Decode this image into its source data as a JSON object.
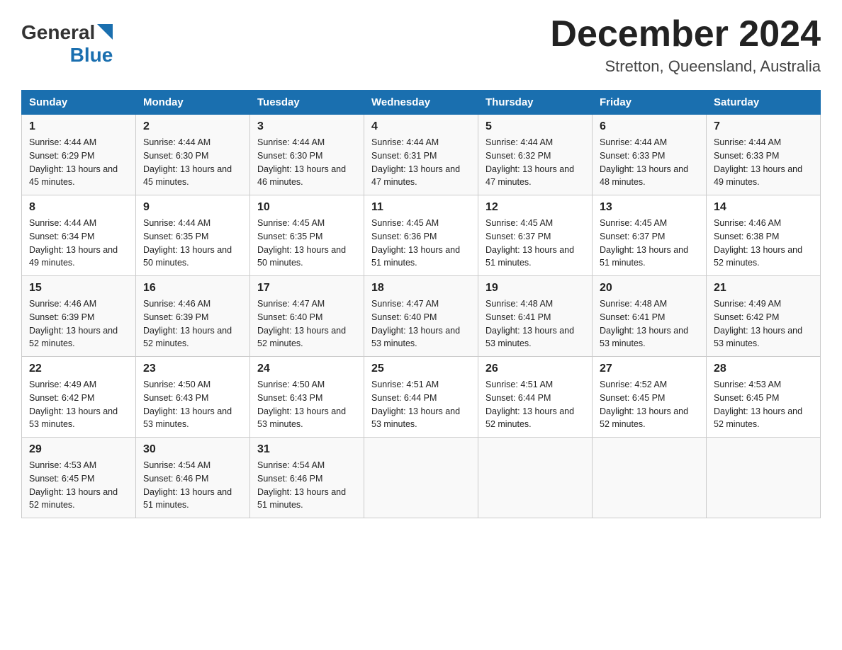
{
  "header": {
    "logo_general": "General",
    "logo_blue": "Blue",
    "month": "December 2024",
    "location": "Stretton, Queensland, Australia"
  },
  "weekdays": [
    "Sunday",
    "Monday",
    "Tuesday",
    "Wednesday",
    "Thursday",
    "Friday",
    "Saturday"
  ],
  "weeks": [
    [
      {
        "day": "1",
        "sunrise": "4:44 AM",
        "sunset": "6:29 PM",
        "daylight": "13 hours and 45 minutes."
      },
      {
        "day": "2",
        "sunrise": "4:44 AM",
        "sunset": "6:30 PM",
        "daylight": "13 hours and 45 minutes."
      },
      {
        "day": "3",
        "sunrise": "4:44 AM",
        "sunset": "6:30 PM",
        "daylight": "13 hours and 46 minutes."
      },
      {
        "day": "4",
        "sunrise": "4:44 AM",
        "sunset": "6:31 PM",
        "daylight": "13 hours and 47 minutes."
      },
      {
        "day": "5",
        "sunrise": "4:44 AM",
        "sunset": "6:32 PM",
        "daylight": "13 hours and 47 minutes."
      },
      {
        "day": "6",
        "sunrise": "4:44 AM",
        "sunset": "6:33 PM",
        "daylight": "13 hours and 48 minutes."
      },
      {
        "day": "7",
        "sunrise": "4:44 AM",
        "sunset": "6:33 PM",
        "daylight": "13 hours and 49 minutes."
      }
    ],
    [
      {
        "day": "8",
        "sunrise": "4:44 AM",
        "sunset": "6:34 PM",
        "daylight": "13 hours and 49 minutes."
      },
      {
        "day": "9",
        "sunrise": "4:44 AM",
        "sunset": "6:35 PM",
        "daylight": "13 hours and 50 minutes."
      },
      {
        "day": "10",
        "sunrise": "4:45 AM",
        "sunset": "6:35 PM",
        "daylight": "13 hours and 50 minutes."
      },
      {
        "day": "11",
        "sunrise": "4:45 AM",
        "sunset": "6:36 PM",
        "daylight": "13 hours and 51 minutes."
      },
      {
        "day": "12",
        "sunrise": "4:45 AM",
        "sunset": "6:37 PM",
        "daylight": "13 hours and 51 minutes."
      },
      {
        "day": "13",
        "sunrise": "4:45 AM",
        "sunset": "6:37 PM",
        "daylight": "13 hours and 51 minutes."
      },
      {
        "day": "14",
        "sunrise": "4:46 AM",
        "sunset": "6:38 PM",
        "daylight": "13 hours and 52 minutes."
      }
    ],
    [
      {
        "day": "15",
        "sunrise": "4:46 AM",
        "sunset": "6:39 PM",
        "daylight": "13 hours and 52 minutes."
      },
      {
        "day": "16",
        "sunrise": "4:46 AM",
        "sunset": "6:39 PM",
        "daylight": "13 hours and 52 minutes."
      },
      {
        "day": "17",
        "sunrise": "4:47 AM",
        "sunset": "6:40 PM",
        "daylight": "13 hours and 52 minutes."
      },
      {
        "day": "18",
        "sunrise": "4:47 AM",
        "sunset": "6:40 PM",
        "daylight": "13 hours and 53 minutes."
      },
      {
        "day": "19",
        "sunrise": "4:48 AM",
        "sunset": "6:41 PM",
        "daylight": "13 hours and 53 minutes."
      },
      {
        "day": "20",
        "sunrise": "4:48 AM",
        "sunset": "6:41 PM",
        "daylight": "13 hours and 53 minutes."
      },
      {
        "day": "21",
        "sunrise": "4:49 AM",
        "sunset": "6:42 PM",
        "daylight": "13 hours and 53 minutes."
      }
    ],
    [
      {
        "day": "22",
        "sunrise": "4:49 AM",
        "sunset": "6:42 PM",
        "daylight": "13 hours and 53 minutes."
      },
      {
        "day": "23",
        "sunrise": "4:50 AM",
        "sunset": "6:43 PM",
        "daylight": "13 hours and 53 minutes."
      },
      {
        "day": "24",
        "sunrise": "4:50 AM",
        "sunset": "6:43 PM",
        "daylight": "13 hours and 53 minutes."
      },
      {
        "day": "25",
        "sunrise": "4:51 AM",
        "sunset": "6:44 PM",
        "daylight": "13 hours and 53 minutes."
      },
      {
        "day": "26",
        "sunrise": "4:51 AM",
        "sunset": "6:44 PM",
        "daylight": "13 hours and 52 minutes."
      },
      {
        "day": "27",
        "sunrise": "4:52 AM",
        "sunset": "6:45 PM",
        "daylight": "13 hours and 52 minutes."
      },
      {
        "day": "28",
        "sunrise": "4:53 AM",
        "sunset": "6:45 PM",
        "daylight": "13 hours and 52 minutes."
      }
    ],
    [
      {
        "day": "29",
        "sunrise": "4:53 AM",
        "sunset": "6:45 PM",
        "daylight": "13 hours and 52 minutes."
      },
      {
        "day": "30",
        "sunrise": "4:54 AM",
        "sunset": "6:46 PM",
        "daylight": "13 hours and 51 minutes."
      },
      {
        "day": "31",
        "sunrise": "4:54 AM",
        "sunset": "6:46 PM",
        "daylight": "13 hours and 51 minutes."
      },
      null,
      null,
      null,
      null
    ]
  ]
}
